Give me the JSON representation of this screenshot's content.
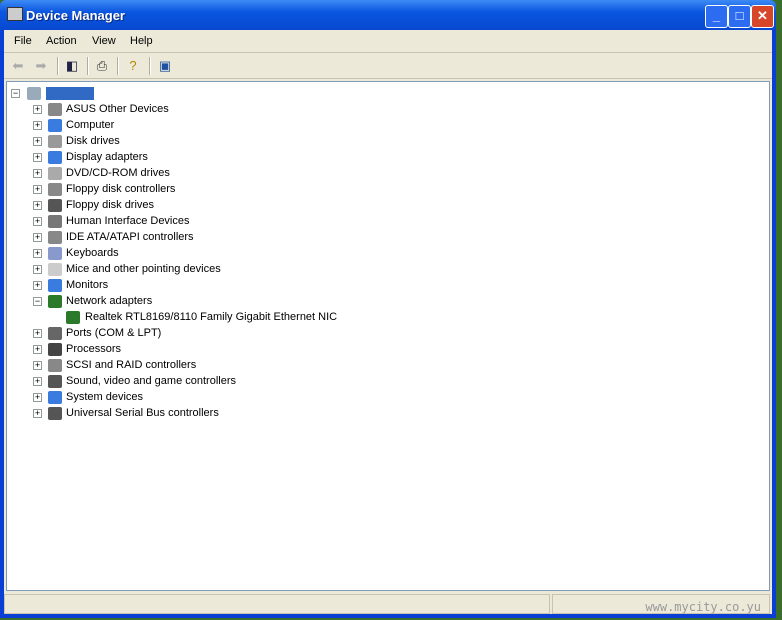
{
  "window": {
    "title": "Device Manager"
  },
  "menu": [
    "File",
    "Action",
    "View",
    "Help"
  ],
  "toolbar": {
    "icons": [
      "back-icon",
      "forward-icon",
      "show-hide-console-tree-icon",
      "print-icon",
      "properties-help-icon",
      "scan-hardware-icon"
    ]
  },
  "tree": {
    "root": {
      "label": ""
    },
    "items": [
      {
        "label": "ASUS Other Devices",
        "color": "#888"
      },
      {
        "label": "Computer",
        "color": "#3a7be0"
      },
      {
        "label": "Disk drives",
        "color": "#999"
      },
      {
        "label": "Display adapters",
        "color": "#3a7be0"
      },
      {
        "label": "DVD/CD-ROM drives",
        "color": "#aaa"
      },
      {
        "label": "Floppy disk controllers",
        "color": "#888"
      },
      {
        "label": "Floppy disk drives",
        "color": "#555"
      },
      {
        "label": "Human Interface Devices",
        "color": "#777"
      },
      {
        "label": "IDE ATA/ATAPI controllers",
        "color": "#888"
      },
      {
        "label": "Keyboards",
        "color": "#8899cc"
      },
      {
        "label": "Mice and other pointing devices",
        "color": "#ccc"
      },
      {
        "label": "Monitors",
        "color": "#3a7be0"
      },
      {
        "label": "Network adapters",
        "color": "#2a7a2a",
        "expanded": true,
        "children": [
          {
            "label": "Realtek RTL8169/8110 Family Gigabit Ethernet NIC",
            "color": "#2a7a2a"
          }
        ]
      },
      {
        "label": "Ports (COM & LPT)",
        "color": "#666"
      },
      {
        "label": "Processors",
        "color": "#444"
      },
      {
        "label": "SCSI and RAID controllers",
        "color": "#888"
      },
      {
        "label": "Sound, video and game controllers",
        "color": "#555"
      },
      {
        "label": "System devices",
        "color": "#3a7be0"
      },
      {
        "label": "Universal Serial Bus controllers",
        "color": "#555"
      }
    ]
  },
  "watermark": "www.mycity.co.yu"
}
